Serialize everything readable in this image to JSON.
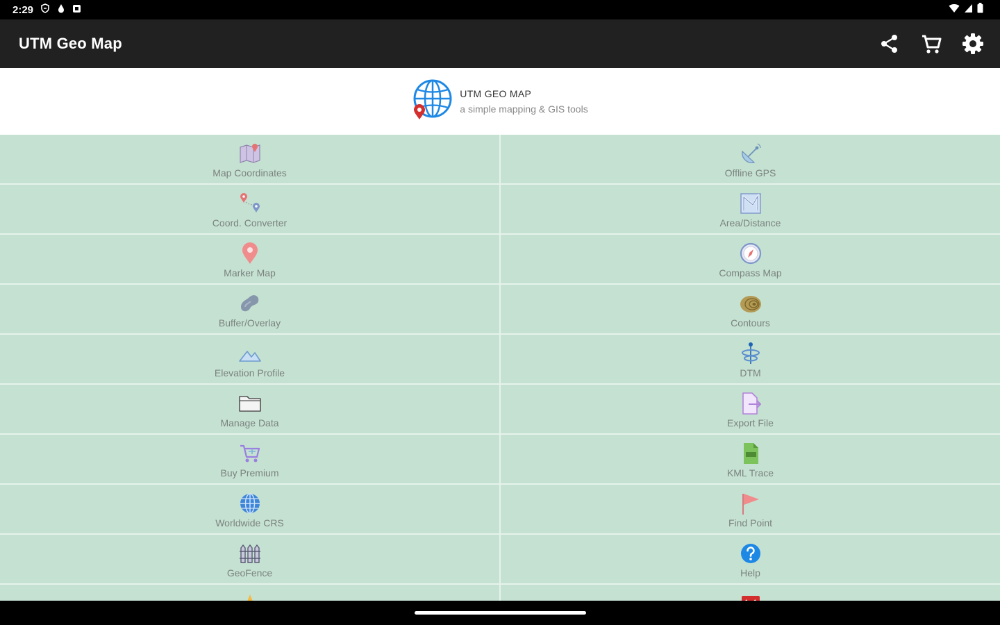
{
  "status": {
    "time": "2:29"
  },
  "app": {
    "title": "UTM Geo Map"
  },
  "actions": {
    "share": "share-icon",
    "cart": "cart-icon",
    "settings": "gear-icon"
  },
  "banner": {
    "title": "UTM GEO MAP",
    "subtitle": "a simple mapping & GIS tools"
  },
  "tiles": [
    {
      "label": "Map Coordinates",
      "icon": "map-coordinates-icon"
    },
    {
      "label": "Offline GPS",
      "icon": "satellite-dish-icon"
    },
    {
      "label": "Coord. Converter",
      "icon": "coord-converter-icon"
    },
    {
      "label": "Area/Distance",
      "icon": "area-distance-icon"
    },
    {
      "label": "Marker Map",
      "icon": "marker-icon"
    },
    {
      "label": "Compass Map",
      "icon": "compass-icon"
    },
    {
      "label": "Buffer/Overlay",
      "icon": "buffer-overlay-icon"
    },
    {
      "label": "Contours",
      "icon": "contours-icon"
    },
    {
      "label": "Elevation Profile",
      "icon": "elevation-profile-icon"
    },
    {
      "label": "DTM",
      "icon": "dtm-icon"
    },
    {
      "label": "Manage Data",
      "icon": "folder-icon"
    },
    {
      "label": "Export File",
      "icon": "export-file-icon"
    },
    {
      "label": "Buy Premium",
      "icon": "premium-cart-icon"
    },
    {
      "label": "KML Trace",
      "icon": "kml-file-icon"
    },
    {
      "label": "Worldwide CRS",
      "icon": "globe-grid-icon"
    },
    {
      "label": "Find Point",
      "icon": "flag-icon"
    },
    {
      "label": "GeoFence",
      "icon": "geofence-icon"
    },
    {
      "label": "Help",
      "icon": "help-icon"
    },
    {
      "label": "",
      "icon": "star-icon"
    },
    {
      "label": "",
      "icon": "red-app-icon"
    }
  ],
  "colors": {
    "tile_bg": "#c5e1d2",
    "appbar": "#212121",
    "divider": "#e6f2ec"
  }
}
